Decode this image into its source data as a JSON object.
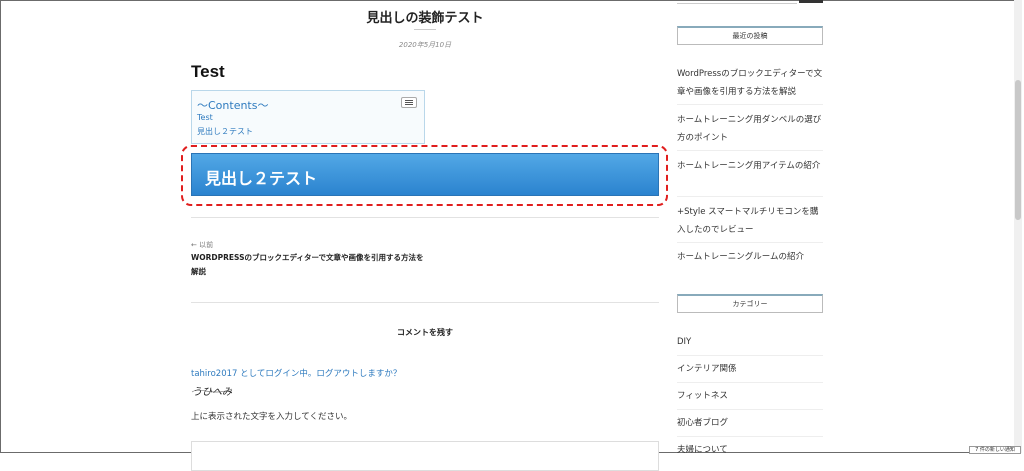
{
  "post": {
    "title": "見出しの装飾テスト",
    "date": "2020年5月10日",
    "heading1": "Test",
    "toc": {
      "title": "〜Contents〜",
      "items": [
        "Test",
        "見出し２テスト"
      ]
    },
    "heading2": "見出し２テスト"
  },
  "nav": {
    "prev_label": "← 以前",
    "prev_title": "WORDPRESSのブロックエディターで文章や画像を引用する方法を解説"
  },
  "comments": {
    "heading": "コメントを残す",
    "login_line": "tahiro2017 としてログイン中。ログアウトしますか？",
    "captcha_text": "うひへみ",
    "captcha_instruction": "上に表示された文字を入力してください。"
  },
  "sidebar": {
    "recent_heading": "最近の投稿",
    "recent_posts": [
      "WordPressのブロックエディターで文章や画像を引用する方法を解説",
      "ホームトレーニング用ダンベルの選び方のポイント",
      "ホームトレーニング用アイテムの紹介",
      "+Style スマートマルチリモコンを購入したのでレビュー",
      "ホームトレーニングルームの紹介"
    ],
    "category_heading": "カテゴリー",
    "categories": [
      "DIY",
      "インテリア関係",
      "フィットネス",
      "初心者ブログ",
      "夫婦について"
    ]
  },
  "notice": "7 件の新しい通知",
  "colors": {
    "link": "#2f7bbf",
    "h2_bg": "#3b95dc",
    "highlight_border": "#e01e1e"
  }
}
